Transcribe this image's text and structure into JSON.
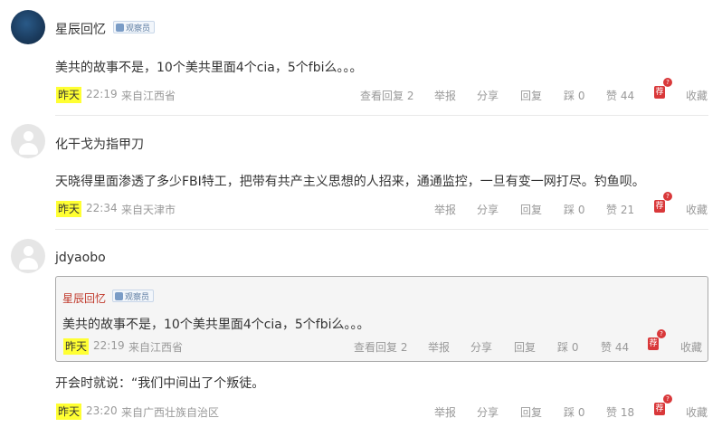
{
  "labels": {
    "day": "昨天",
    "view_replies": "查看回复",
    "report": "举报",
    "share": "分享",
    "reply": "回复",
    "dislike": "踩",
    "like": "赞",
    "recommend_icon_text": "荐",
    "recommend_help_text": "?",
    "collect": "收藏"
  },
  "comments": [
    {
      "user": "星辰回忆",
      "badge": "观察员",
      "text": "美共的故事不是，10个美共里面4个cia，5个fbi么。。。",
      "time": "22:19",
      "location": "来自江西省",
      "replies_count": "2",
      "dislikes": "0",
      "likes": "44"
    },
    {
      "user": "化干戈为指甲刀",
      "text": "天晓得里面渗透了多少FBI特工，把带有共产主义思想的人招来，通通监控，一旦有变一网打尽。钓鱼呗。",
      "time": "22:34",
      "location": "来自天津市",
      "dislikes": "0",
      "likes": "21"
    },
    {
      "user": "jdyaobo",
      "quote": {
        "user": "星辰回忆",
        "badge": "观察员",
        "text": "美共的故事不是，10个美共里面4个cia，5个fbi么。。。",
        "time": "22:19",
        "location": "来自江西省",
        "replies_count": "2",
        "dislikes": "0",
        "likes": "44"
      },
      "text": "开会时就说：“我们中间出了个叛徒。",
      "time": "23:20",
      "location": "来自广西壮族自治区",
      "dislikes": "0",
      "likes": "18"
    }
  ]
}
